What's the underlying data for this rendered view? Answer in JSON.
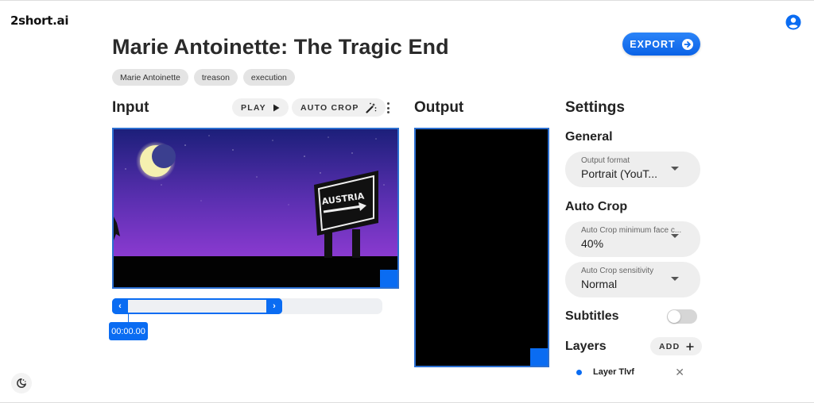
{
  "app": {
    "logo": "2short.ai"
  },
  "header": {
    "title": "Marie Antoinette: The Tragic End",
    "export_label": "EXPORT",
    "tags": [
      "Marie Antoinette",
      "treason",
      "execution"
    ]
  },
  "input": {
    "title": "Input",
    "play_label": "PLAY",
    "autocrop_label": "AUTO CROP",
    "video_sign_text": "AUSTRIA",
    "timeline": {
      "current_time": "00:00.00",
      "range_prev": "‹",
      "range_next": "›"
    }
  },
  "output": {
    "title": "Output"
  },
  "settings": {
    "title": "Settings",
    "general": {
      "title": "General",
      "output_format": {
        "label": "Output format",
        "value": "Portrait (YouT..."
      }
    },
    "auto_crop": {
      "title": "Auto Crop",
      "min_face": {
        "label": "Auto Crop minimum face c...",
        "value": "40%"
      },
      "sensitivity": {
        "label": "Auto Crop sensitivity",
        "value": "Normal"
      }
    },
    "subtitles": {
      "title": "Subtitles",
      "enabled": false
    },
    "layers": {
      "title": "Layers",
      "add_label": "ADD",
      "items": [
        {
          "name": "Layer Tlvf",
          "color": "#0a6cf2"
        }
      ]
    }
  },
  "colors": {
    "accent": "#0a6cf2",
    "pill_bg": "#eeeeee"
  },
  "icons": {
    "account": "account-circle-icon",
    "export_arrow": "arrow-right-circle-icon",
    "play": "play-icon",
    "autocrop": "magic-wand-icon",
    "more": "more-vert-icon",
    "theme": "dark-mode-icon",
    "add": "plus-icon",
    "close": "close-icon"
  }
}
